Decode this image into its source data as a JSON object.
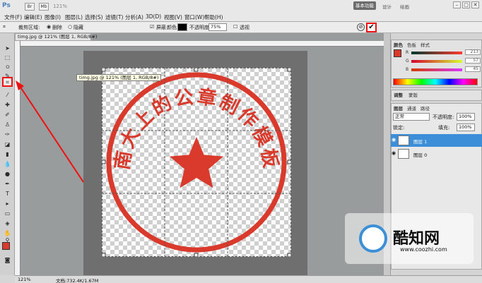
{
  "app": {
    "logo": "Ps",
    "title_controls": [
      "Br",
      "Mb",
      "121%"
    ],
    "workspace_active": "基本功能",
    "workspace_links": [
      "设计",
      "绘画"
    ],
    "window_buttons": [
      "–",
      "▢",
      "✕"
    ]
  },
  "menu": [
    "文件(F)",
    "编辑(E)",
    "图像(I)",
    "图层(L)",
    "选择(S)",
    "滤镜(T)",
    "分析(A)",
    "3D(D)",
    "视图(V)",
    "窗口(W)",
    "帮助(H)"
  ],
  "options": {
    "tool_label": "裁剪区域:",
    "delete_label": "删除",
    "hide_label": "隐藏",
    "shield_label": "屏蔽",
    "shield_color_label": "颜色:",
    "opacity_label": "不透明度:",
    "opacity_value": "75%",
    "perspective_label": "透视",
    "cancel_icon": "cancel-icon",
    "commit_icon": "checkmark-icon"
  },
  "document": {
    "tab_label": "timg.jpg @ 121% (图层 1, RGB/8#)",
    "tooltip": "timg.jpg @ 121% (图层 1, RGB/8#)",
    "seal_text": "南大上的公章制作模板"
  },
  "status": {
    "zoom": "121%",
    "doc_info": "文档:732.4K/1.67M"
  },
  "panels": {
    "color_tabs": [
      "颜色",
      "色板",
      "样式"
    ],
    "color_values": {
      "r": "213",
      "g": "57",
      "b": "45"
    },
    "adjust_tabs": [
      "调整",
      "蒙版"
    ],
    "layers_tabs": [
      "图层",
      "通道",
      "路径"
    ],
    "blend_mode": "正常",
    "opacity_label": "不透明度:",
    "opacity_value": "100%",
    "lock_label": "锁定:",
    "fill_label": "填充:",
    "fill_value": "100%",
    "layers": [
      {
        "name": "图层 1",
        "selected": true
      },
      {
        "name": "图层 0",
        "selected": false
      }
    ]
  },
  "colors": {
    "accent_red": "#e11111",
    "seal_red": "#d93a2c",
    "selection_blue": "#3c8ed8"
  },
  "watermark": {
    "name": "酷知网",
    "url": "www.coozhi.com"
  }
}
